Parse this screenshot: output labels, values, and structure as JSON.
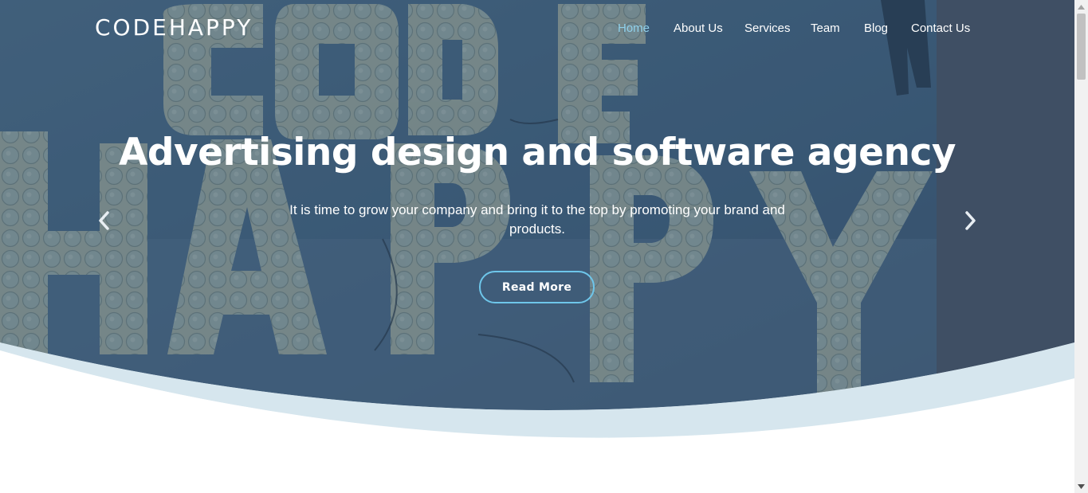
{
  "brand": {
    "name": "CODEHAPPY"
  },
  "nav": {
    "items": [
      {
        "label": "Home",
        "active": true
      },
      {
        "label": "About Us",
        "active": false
      },
      {
        "label": "Services",
        "active": false
      },
      {
        "label": "Team",
        "active": false
      },
      {
        "label": "Blog",
        "active": false
      },
      {
        "label": "Contact Us",
        "active": false
      }
    ]
  },
  "hero": {
    "title": "Advertising design and software agency",
    "subtitle": "It is time to grow your company and bring it to the top by promoting your brand and products.",
    "cta_label": "Read More",
    "background_image": "marquee light-bulb letters spelling CODE HAPPY",
    "prev_icon": "chevron-left-icon",
    "next_icon": "chevron-right-icon"
  },
  "colors": {
    "overlay": "#3a5670",
    "accent": "#6ec6ea",
    "nav_active": "#8fd0ea",
    "wave": "#d6e6ee",
    "bulb_letters": "#c9c8a5"
  }
}
